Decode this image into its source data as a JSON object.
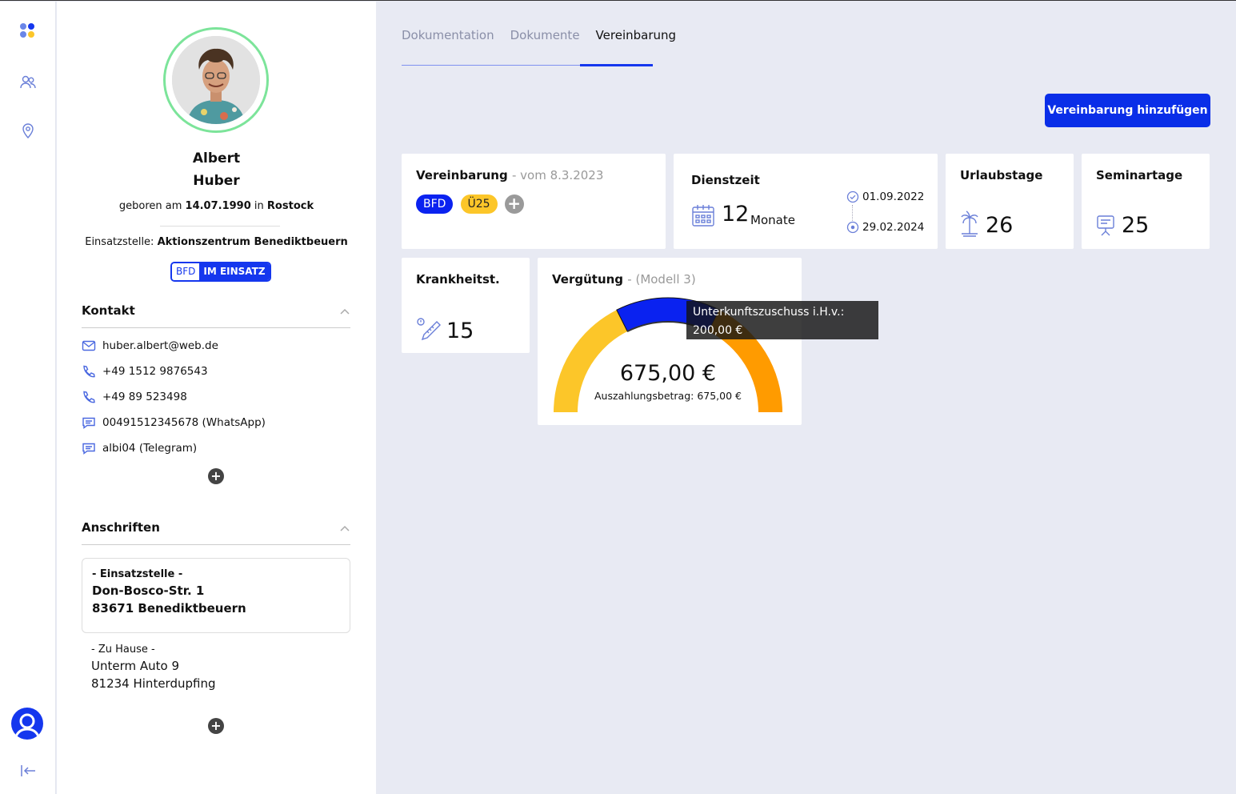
{
  "person": {
    "first_name": "Albert",
    "last_name": "Huber",
    "born_prefix": "geboren am",
    "born_date": "14.07.1990",
    "born_in": "in",
    "born_place": "Rostock",
    "einsatz_label": "Einsatzstelle:",
    "einsatz_value": "Aktionszentrum Benediktbeuern",
    "status_program": "BFD",
    "status_state": "IM EINSATZ"
  },
  "kontakt": {
    "title": "Kontakt",
    "items": [
      {
        "icon": "mail-icon",
        "text": "huber.albert@web.de"
      },
      {
        "icon": "phone-icon",
        "text": "+49 1512 9876543"
      },
      {
        "icon": "phone-icon",
        "text": "+49 89 523498"
      },
      {
        "icon": "chat-icon",
        "text": "00491512345678 (WhatsApp)"
      },
      {
        "icon": "chat-icon",
        "text": "albi04 (Telegram)"
      }
    ]
  },
  "anschriften": {
    "title": "Anschriften",
    "einsatzstelle": {
      "label": "- Einsatzstelle -",
      "street": "Don-Bosco-Str. 1",
      "city": "83671 Benediktbeuern"
    },
    "home": {
      "label": "- Zu Hause -",
      "street": "Unterm Auto 9",
      "city": "81234 Hinterdupfing"
    }
  },
  "tabs": [
    "Dokumentation",
    "Dokumente",
    "Vereinbarung"
  ],
  "active_tab": "Vereinbarung",
  "add_button": "Vereinbarung hinzufügen",
  "vereinbarung": {
    "title": "Vereinbarung",
    "sub": "- vom 8.3.2023",
    "chips": [
      "BFD",
      "Ü25"
    ]
  },
  "dienstzeit": {
    "title": "Dienstzeit",
    "value": "12",
    "unit": "Monate",
    "start": "01.09.2022",
    "end": "29.02.2024"
  },
  "urlaubstage": {
    "title": "Urlaubstage",
    "value": "26"
  },
  "seminartage": {
    "title": "Seminartage",
    "value": "25"
  },
  "krankheit": {
    "title": "Krankheitst.",
    "value": "15"
  },
  "verguetung": {
    "title": "Vergütung",
    "sub": "- (Modell 3)",
    "total": "675,00 €",
    "payout": "Auszahlungsbetrag: 675,00 €",
    "tooltip_label": "Unterkunftszuschuss i.H.v.:",
    "tooltip_value": "200,00 €"
  },
  "chart_data": {
    "type": "pie",
    "title": "Vergütung",
    "variant": "semi-donut",
    "slices": [
      {
        "value": 237.5,
        "color": "#fcc629"
      },
      {
        "value": 200,
        "color": "#0a22f0",
        "tooltip": "Unterkunftszuschuss i.H.v.: 200,00 €"
      },
      {
        "value": 237.5,
        "color": "#ff9b00"
      }
    ],
    "total": 675
  },
  "colors": {
    "accent": "#0a2ee8",
    "chip_bfd": "#0a22f0",
    "chip_u25": "#fcc629",
    "ring": "#7ce49a"
  }
}
